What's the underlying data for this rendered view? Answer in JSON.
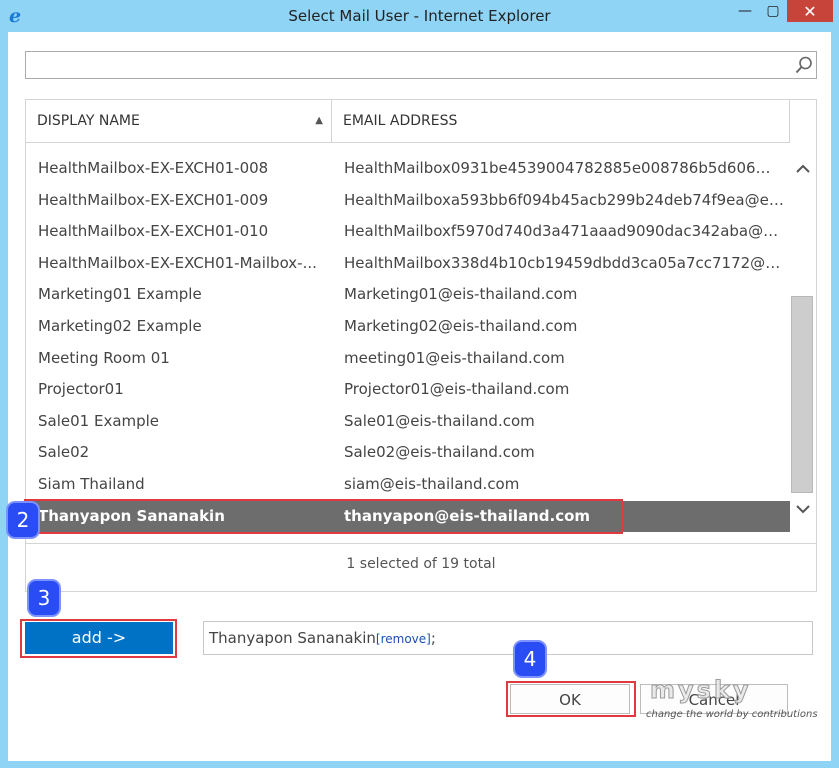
{
  "window": {
    "title": "Select Mail User - Internet Explorer",
    "minimize_icon": "minimize-icon",
    "maximize_icon": "maximize-icon",
    "close_icon": "close-icon",
    "minimize_glyph": "—",
    "maximize_glyph": "▢",
    "close_glyph": "✕",
    "app_icon_glyph": "e"
  },
  "search": {
    "value": "",
    "placeholder": "",
    "icon": "search-icon"
  },
  "table": {
    "columns": [
      "DISPLAY NAME",
      "EMAIL ADDRESS"
    ],
    "sort_indicator": "▲",
    "rows": [
      {
        "name": "HealthMailbox-EX-EXCH01-008",
        "email": "HealthMailbox0931be4539004782885e008786b5d606@ei..."
      },
      {
        "name": "HealthMailbox-EX-EXCH01-009",
        "email": "HealthMailboxa593bb6f094b45acb299b24deb74f9ea@eis..."
      },
      {
        "name": "HealthMailbox-EX-EXCH01-010",
        "email": "HealthMailboxf5970d740d3a471aaad9090dac342aba@eis..."
      },
      {
        "name": "HealthMailbox-EX-EXCH01-Mailbox-...",
        "email": "HealthMailbox338d4b10cb19459dbdd3ca05a7cc7172@eis..."
      },
      {
        "name": "Marketing01 Example",
        "email": "Marketing01@eis-thailand.com"
      },
      {
        "name": "Marketing02 Example",
        "email": "Marketing02@eis-thailand.com"
      },
      {
        "name": "Meeting Room 01",
        "email": "meeting01@eis-thailand.com"
      },
      {
        "name": "Projector01",
        "email": "Projector01@eis-thailand.com"
      },
      {
        "name": "Sale01 Example",
        "email": "Sale01@eis-thailand.com"
      },
      {
        "name": "Sale02",
        "email": "Sale02@eis-thailand.com"
      },
      {
        "name": "Siam Thailand",
        "email": "siam@eis-thailand.com"
      },
      {
        "name": "Thanyapon Sananakin",
        "email": "thanyapon@eis-thailand.com",
        "selected": true
      }
    ],
    "status": "1 selected of 19 total"
  },
  "add_button": "add ->",
  "picked": {
    "name": "Thanyapon Sananakin",
    "remove_label": "[remove]",
    "separator": ";"
  },
  "ok_button": "OK",
  "cancel_button": "Cancel",
  "badges": [
    "2",
    "3",
    "4"
  ],
  "watermark": {
    "main": "mysky",
    "sub": "change the world by contributions"
  },
  "colors": {
    "accent": "#0072c6",
    "selected_row": "#6d6d6d",
    "highlight": "#e0393e",
    "badge": "#2a4cf5",
    "frame": "#8fd3f5"
  }
}
